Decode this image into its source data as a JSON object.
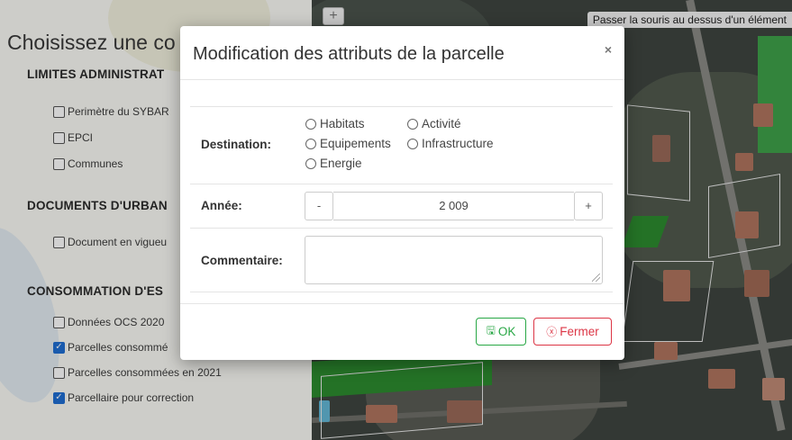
{
  "panel": {
    "title": "Choisissez une co",
    "sections": [
      {
        "title": "LIMITES ADMINISTRAT",
        "items": [
          {
            "label": "Perimètre du SYBAR",
            "checked": false
          },
          {
            "label": "EPCI",
            "checked": false
          },
          {
            "label": "Communes",
            "checked": false
          }
        ]
      },
      {
        "title": "DOCUMENTS D'URBAN",
        "items": [
          {
            "label": "Document en vigueu",
            "checked": false
          }
        ]
      },
      {
        "title": "CONSOMMATION D'ES",
        "items": [
          {
            "label": "Données OCS 2020",
            "checked": false
          },
          {
            "label": "Parcelles consommé",
            "checked": true
          },
          {
            "label": "Parcelles consommées en 2021",
            "checked": false
          },
          {
            "label": "Parcellaire pour correction",
            "checked": true
          }
        ]
      }
    ]
  },
  "map": {
    "zoom_in_label": "+",
    "tooltip": "Passer la souris au dessus d'un élément"
  },
  "modal": {
    "title": "Modification des attributs de la parcelle",
    "close_glyph": "×",
    "destination": {
      "label": "Destination:",
      "options": [
        "Habitats",
        "Activité",
        "Equipements",
        "Infrastructure",
        "Energie"
      ]
    },
    "annee": {
      "label": "Année:",
      "value": "2 009",
      "decrement_label": "-",
      "increment_label": "+"
    },
    "commentaire": {
      "label": "Commentaire:",
      "value": ""
    },
    "buttons": {
      "ok_label": "OK",
      "close_label": "Fermer"
    }
  },
  "colors": {
    "ok": "#28a745",
    "close": "#dc3545",
    "checkbox_checked": "#1f6ed4",
    "parcel_green": "#2c8b2f"
  }
}
